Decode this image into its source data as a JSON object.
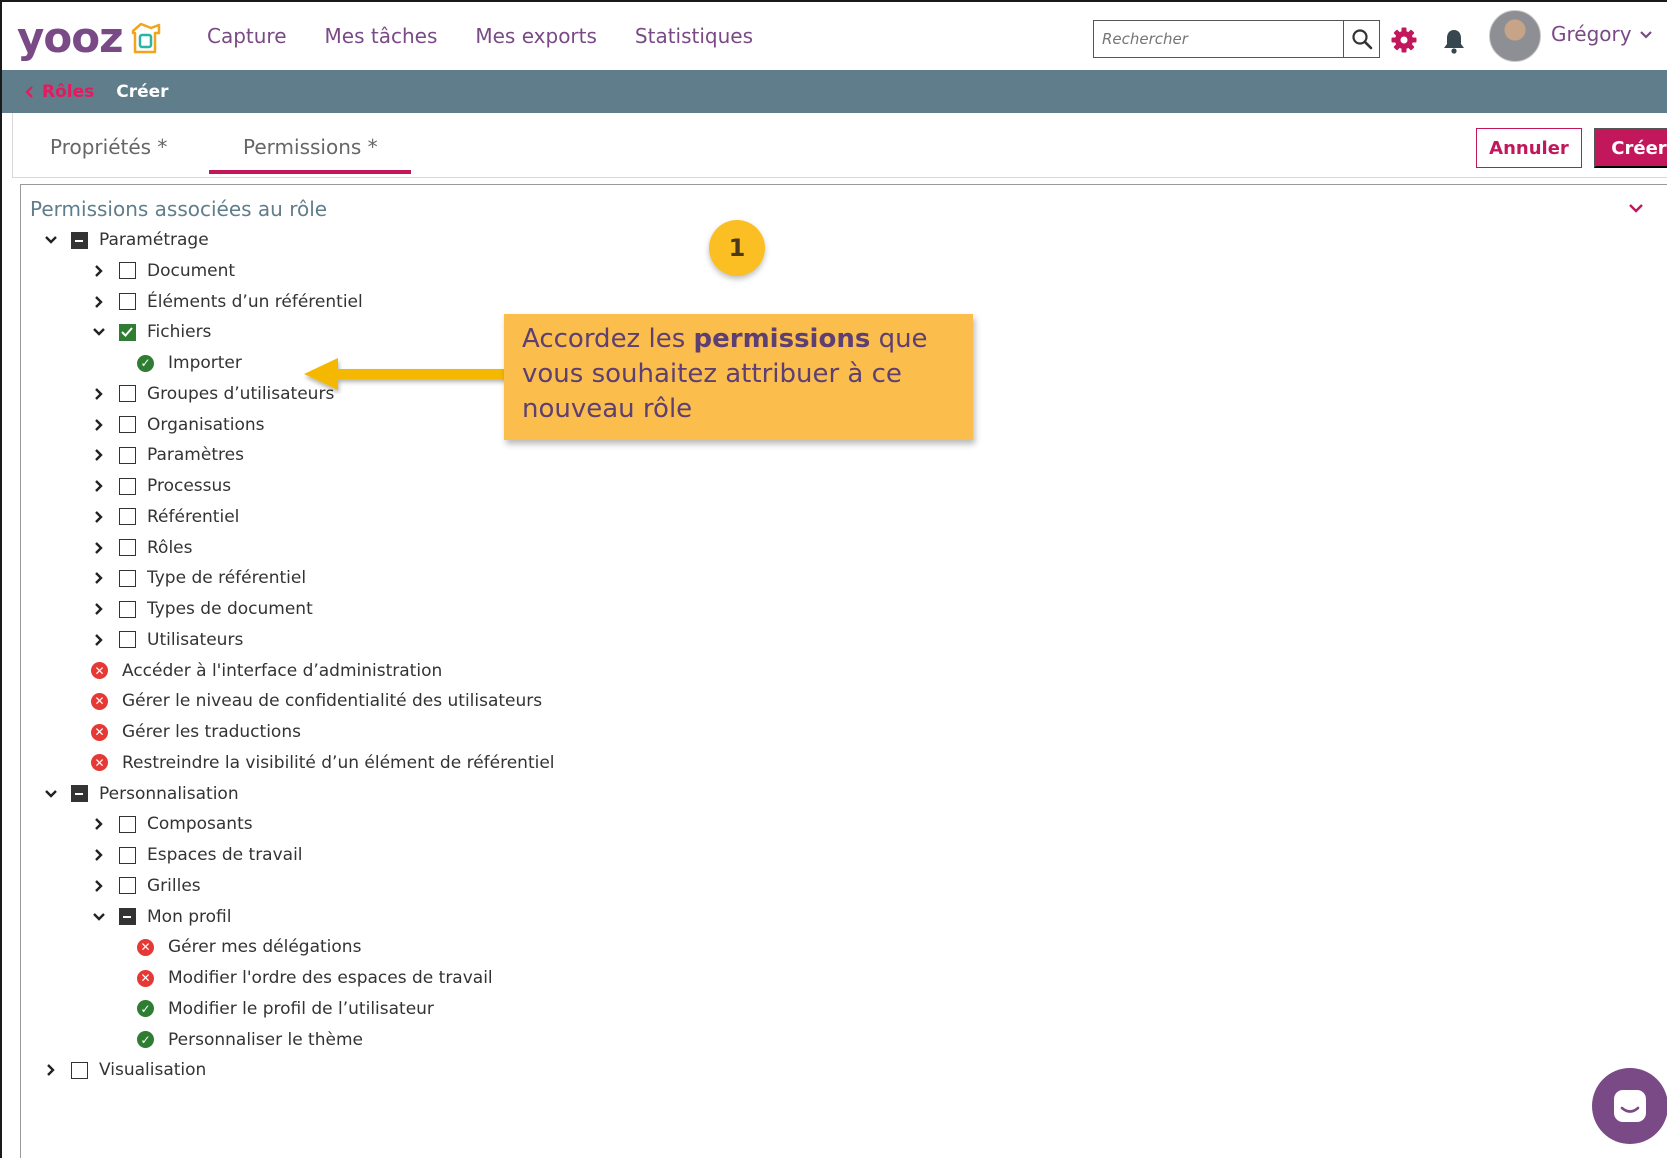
{
  "logo": {
    "text": "yooz"
  },
  "nav": [
    {
      "label": "Capture"
    },
    {
      "label": "Mes tâches"
    },
    {
      "label": "Mes exports"
    },
    {
      "label": "Statistiques"
    }
  ],
  "search": {
    "placeholder": "Rechercher"
  },
  "user": {
    "name": "Grégory"
  },
  "breadcrumb": {
    "back": "Rôles",
    "current": "Créer"
  },
  "tabs": [
    {
      "label": "Propriétés *"
    },
    {
      "label": "Permissions *"
    }
  ],
  "actions": {
    "cancel": "Annuler",
    "create": "Créer"
  },
  "panel": {
    "title": "Permissions associées au rôle"
  },
  "tree": [
    {
      "label": "Paramétrage",
      "level": 0,
      "expander": "down",
      "state": "partial"
    },
    {
      "label": "Document",
      "level": 1,
      "expander": "right",
      "state": "unchecked"
    },
    {
      "label": "Éléments d’un référentiel",
      "level": 1,
      "expander": "right",
      "state": "unchecked"
    },
    {
      "label": "Fichiers",
      "level": 1,
      "expander": "down",
      "state": "checked"
    },
    {
      "label": "Importer",
      "level": 2,
      "status": "granted"
    },
    {
      "label": "Groupes d’utilisateurs",
      "level": 1,
      "expander": "right",
      "state": "unchecked"
    },
    {
      "label": "Organisations",
      "level": 1,
      "expander": "right",
      "state": "unchecked"
    },
    {
      "label": "Paramètres",
      "level": 1,
      "expander": "right",
      "state": "unchecked"
    },
    {
      "label": "Processus",
      "level": 1,
      "expander": "right",
      "state": "unchecked"
    },
    {
      "label": "Référentiel",
      "level": 1,
      "expander": "right",
      "state": "unchecked"
    },
    {
      "label": "Rôles",
      "level": 1,
      "expander": "right",
      "state": "unchecked"
    },
    {
      "label": "Type de référentiel",
      "level": 1,
      "expander": "right",
      "state": "unchecked"
    },
    {
      "label": "Types de document",
      "level": 1,
      "expander": "right",
      "state": "unchecked"
    },
    {
      "label": "Utilisateurs",
      "level": 1,
      "expander": "right",
      "state": "unchecked"
    },
    {
      "label": "Accéder à l'interface d’administration",
      "level": 1,
      "status": "denied"
    },
    {
      "label": "Gérer le niveau de confidentialité des utilisateurs",
      "level": 1,
      "status": "denied"
    },
    {
      "label": "Gérer les traductions",
      "level": 1,
      "status": "denied"
    },
    {
      "label": "Restreindre la visibilité d’un élément de référentiel",
      "level": 1,
      "status": "denied"
    },
    {
      "label": "Personnalisation",
      "level": 0,
      "expander": "down",
      "state": "partial"
    },
    {
      "label": "Composants",
      "level": 1,
      "expander": "right",
      "state": "unchecked"
    },
    {
      "label": "Espaces de travail",
      "level": 1,
      "expander": "right",
      "state": "unchecked"
    },
    {
      "label": "Grilles",
      "level": 1,
      "expander": "right",
      "state": "unchecked"
    },
    {
      "label": "Mon profil",
      "level": 1,
      "expander": "down",
      "state": "partial"
    },
    {
      "label": "Gérer mes délégations",
      "level": 2,
      "status": "denied"
    },
    {
      "label": "Modifier l'ordre des espaces de travail",
      "level": 2,
      "status": "denied"
    },
    {
      "label": "Modifier le profil de l’utilisateur",
      "level": 2,
      "status": "granted"
    },
    {
      "label": "Personnaliser le thème",
      "level": 2,
      "status": "granted"
    },
    {
      "label": "Visualisation",
      "level": 0,
      "expander": "right",
      "state": "unchecked"
    }
  ],
  "callout": {
    "badge": "1",
    "text_before": "Accordez les ",
    "text_bold": "permissions",
    "text_after": " que vous souhaitez attribuer à ce nouveau rôle"
  },
  "colors": {
    "brand": "#7a4a86",
    "accent": "#c2185b",
    "header_bar": "#607d8b",
    "granted": "#2e7d32",
    "denied": "#e53935",
    "callout": "#fbbd4b"
  }
}
